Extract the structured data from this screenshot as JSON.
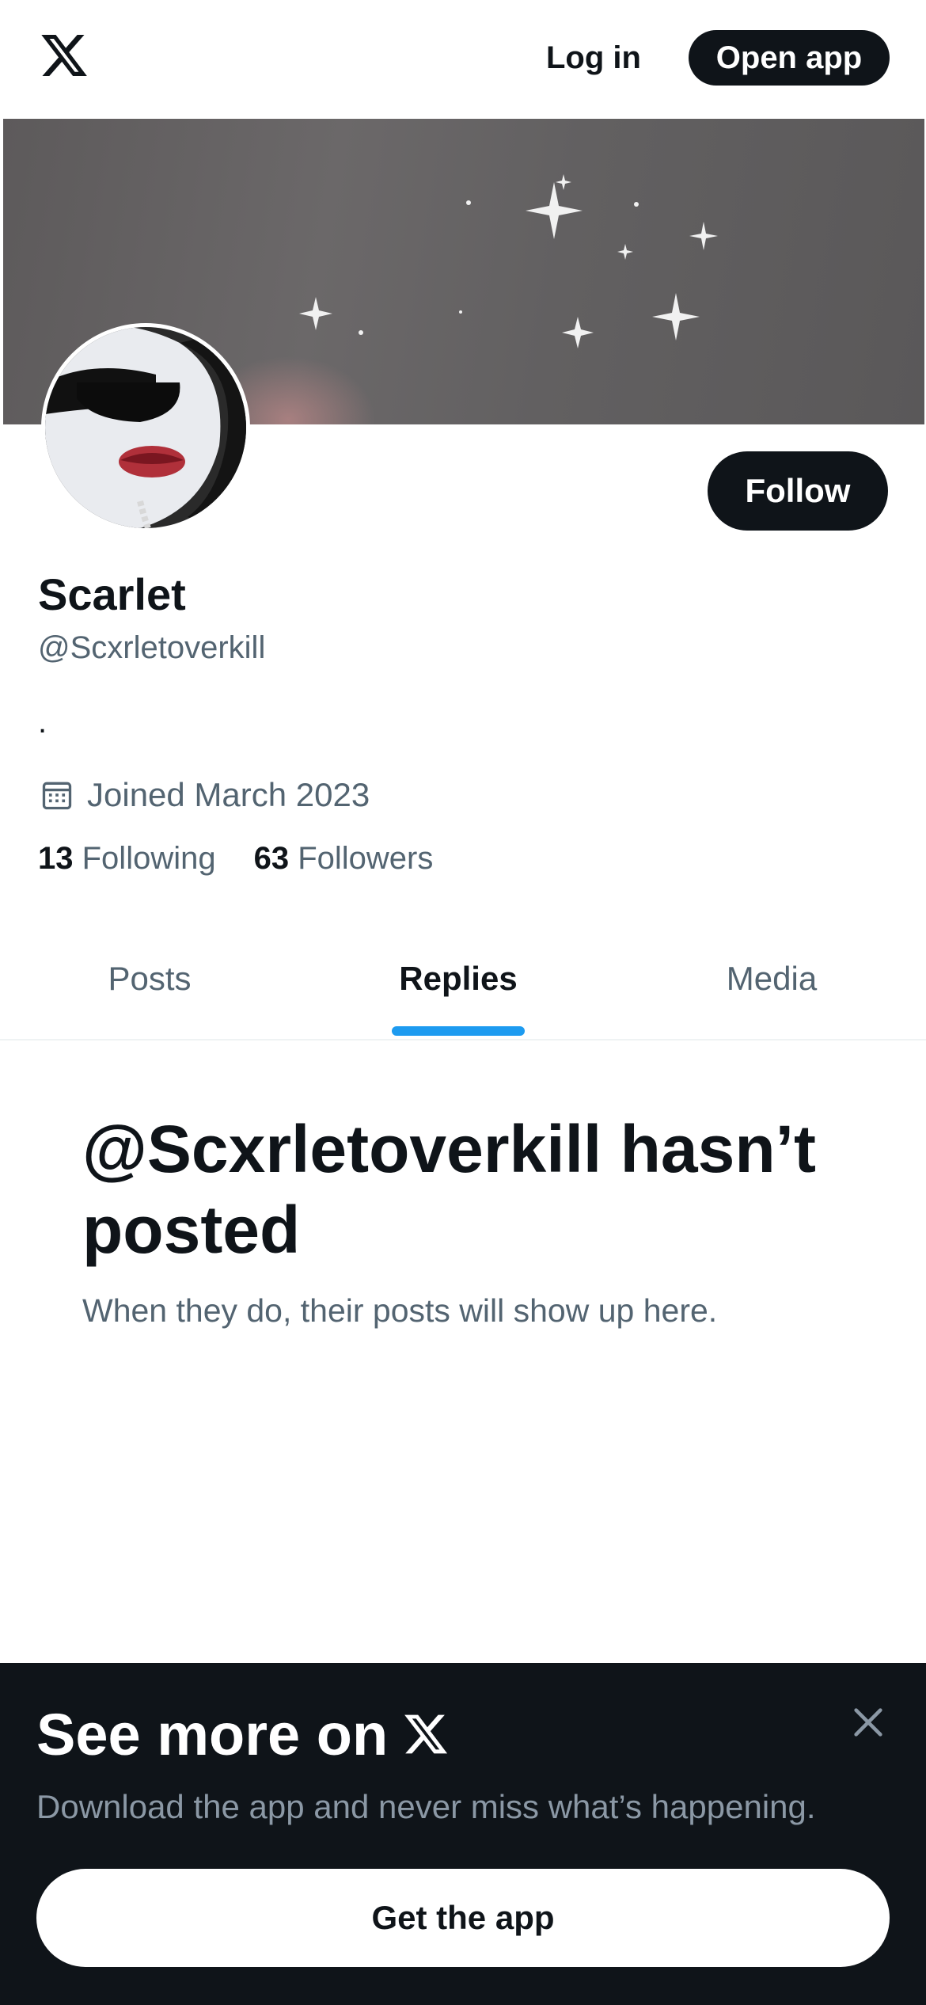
{
  "topbar": {
    "logo_icon": "x-logo-icon",
    "login_label": "Log in",
    "open_app_label": "Open app"
  },
  "profile": {
    "name": "Scarlet",
    "handle": "@Scxrletoverkill",
    "bio": ".",
    "joined": "Joined March 2023",
    "following_count": "13",
    "following_label": "Following",
    "followers_count": "63",
    "followers_label": "Followers",
    "follow_label": "Follow"
  },
  "tabs": [
    {
      "label": "Posts",
      "active": false
    },
    {
      "label": "Replies",
      "active": true
    },
    {
      "label": "Media",
      "active": false
    }
  ],
  "empty_state": {
    "title": "@Scxrletoverkill hasn’t posted",
    "subtitle": "When they do, their posts will show up here."
  },
  "bottom_sheet": {
    "title": "See more on",
    "subtitle": "Download the app and never miss what’s happening.",
    "button_label": "Get the app",
    "close_icon": "close-icon"
  },
  "colors": {
    "accent": "#1d9bf0",
    "dark": "#0f1419",
    "muted": "#536471"
  }
}
